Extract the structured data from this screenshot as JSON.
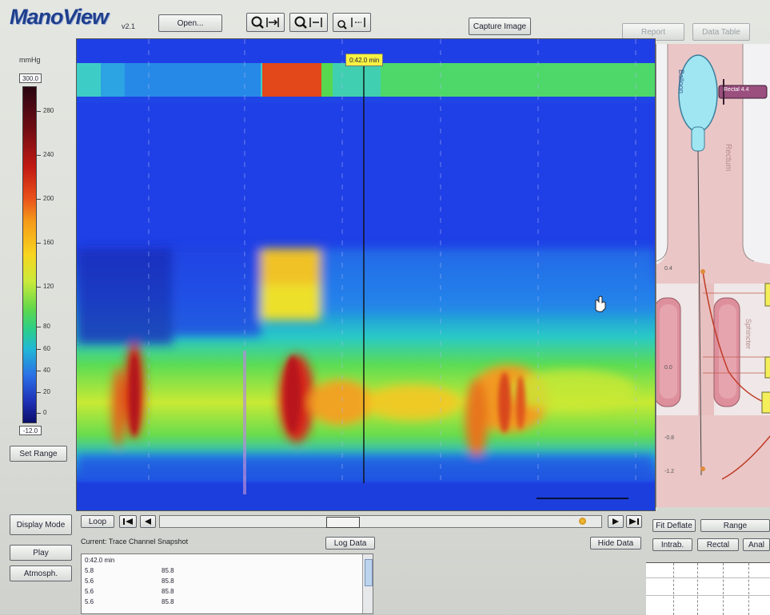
{
  "app": {
    "logo": "ManoView",
    "logo_version": "v2.1"
  },
  "toolbar": {
    "open_label": "Open...",
    "zoom_in_icon": "zoom-in-icon",
    "zoom_out_icon": "zoom-out-icon",
    "zoom_reset_icon": "zoom-reset-icon",
    "capture_label": "Capture Image",
    "report_label": "Report",
    "data_table_label": "Data Table"
  },
  "scale": {
    "unit": "mmHg",
    "max_value": "300.0",
    "min_value": "-12.0",
    "ticks": [
      "280",
      "240",
      "200",
      "160",
      "120",
      "80",
      "60",
      "40",
      "20",
      "0"
    ],
    "set_range_label": "Set Range"
  },
  "plot": {
    "time_marker": "0:42.0 min"
  },
  "left_panel": {
    "display_mode_label": "Display Mode",
    "play_label": "Play",
    "atmosph_label": "Atmosph."
  },
  "transport": {
    "loop_label": "Loop",
    "current_label": "Current:  Trace Channel Snapshot",
    "log_data_label": "Log Data",
    "hide_data_label": "Hide Data"
  },
  "data_list": {
    "header": "0:42.0 min",
    "rows": [
      {
        "pos": "5.8",
        "val": "85.8"
      },
      {
        "pos": "5.6",
        "val": "85.8"
      },
      {
        "pos": "5.6",
        "val": "85.8"
      },
      {
        "pos": "5.6",
        "val": "85.8"
      }
    ]
  },
  "anatomy": {
    "balloon_label": "Balloon",
    "rectum_label": "Rectum",
    "sphincter_label": "Sphincter",
    "rectal_tag": "Rectal 4.4",
    "axis_labels": [
      "0.4",
      "0.0",
      "-0.8",
      "-1.2"
    ]
  },
  "right_buttons": {
    "fit_label": "Fit Deflate",
    "range_label": "Range",
    "intra_label": "Intrab.",
    "rectal_label": "Rectal",
    "anal_label": "Anal"
  },
  "colors": {
    "plot_blue": "#1f3fe6",
    "rectum_pink": "#f1c0c0",
    "balloon_cyan": "#9fe6f2",
    "marker_yellow": "#f7f242"
  }
}
